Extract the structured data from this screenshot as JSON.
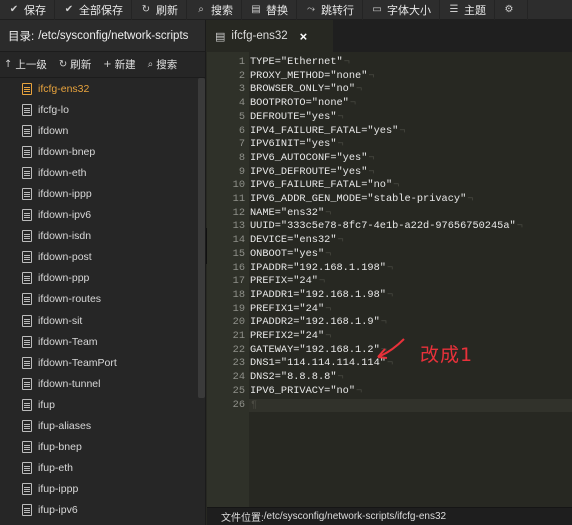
{
  "toolbar": {
    "buttons": [
      {
        "icon": "save-icon",
        "glyph": "✔",
        "label": "保存"
      },
      {
        "icon": "save-all-icon",
        "glyph": "✔",
        "label": "全部保存"
      },
      {
        "icon": "refresh-icon",
        "glyph": "↻",
        "label": "刷新"
      },
      {
        "icon": "search-icon",
        "glyph": "⌕",
        "label": "搜索"
      },
      {
        "icon": "replace-icon",
        "glyph": "▤",
        "label": "替换"
      },
      {
        "icon": "goto-line-icon",
        "glyph": "⤳",
        "label": "跳转行"
      },
      {
        "icon": "font-size-icon",
        "glyph": "▭",
        "label": "字体大小"
      },
      {
        "icon": "theme-icon",
        "glyph": "☰",
        "label": "主题"
      },
      {
        "icon": "settings-icon",
        "glyph": "⚙",
        "label": ""
      }
    ]
  },
  "sidebar": {
    "dir_label": "目录:",
    "dir_path": "/etc/sysconfig/network-scripts",
    "actions": [
      {
        "icon": "up-arrow-icon",
        "glyph": "↑",
        "label": "上一级"
      },
      {
        "icon": "refresh-icon",
        "glyph": "↻",
        "label": "刷新"
      },
      {
        "icon": "plus-icon",
        "glyph": "+",
        "label": "新建"
      },
      {
        "icon": "search-icon",
        "glyph": "⌕",
        "label": "搜索"
      }
    ],
    "files": [
      "ifcfg-ens32",
      "ifcfg-lo",
      "ifdown",
      "ifdown-bnep",
      "ifdown-eth",
      "ifdown-ippp",
      "ifdown-ipv6",
      "ifdown-isdn",
      "ifdown-post",
      "ifdown-ppp",
      "ifdown-routes",
      "ifdown-sit",
      "ifdown-Team",
      "ifdown-TeamPort",
      "ifdown-tunnel",
      "ifup",
      "ifup-aliases",
      "ifup-bnep",
      "ifup-eth",
      "ifup-ippp",
      "ifup-ipv6"
    ],
    "active_file": "ifcfg-ens32"
  },
  "tab": {
    "label": "ifcfg-ens32",
    "close": "×"
  },
  "editor": {
    "lines": [
      "TYPE=\"Ethernet\"",
      "PROXY_METHOD=\"none\"",
      "BROWSER_ONLY=\"no\"",
      "BOOTPROTO=\"none\"",
      "DEFROUTE=\"yes\"",
      "IPV4_FAILURE_FATAL=\"yes\"",
      "IPV6INIT=\"yes\"",
      "IPV6_AUTOCONF=\"yes\"",
      "IPV6_DEFROUTE=\"yes\"",
      "IPV6_FAILURE_FATAL=\"no\"",
      "IPV6_ADDR_GEN_MODE=\"stable-privacy\"",
      "NAME=\"ens32\"",
      "UUID=\"333c5e78-8fc7-4e1b-a22d-97656750245a\"",
      "DEVICE=\"ens32\"",
      "ONBOOT=\"yes\"",
      "IPADDR=\"192.168.1.198\"",
      "PREFIX=\"24\"",
      "IPADDR1=\"192.168.1.98\"",
      "PREFIX1=\"24\"",
      "IPADDR2=\"192.168.1.9\"",
      "PREFIX2=\"24\"",
      "GATEWAY=\"192.168.1.2\"",
      "DNS1=\"114.114.114.114\"",
      "DNS2=\"8.8.8.8\"",
      "IPV6_PRIVACY=\"no\"",
      ""
    ],
    "eol_marker": "¬",
    "last_marker": "¶"
  },
  "annotation": {
    "text": "改成1",
    "color": "#e8313a"
  },
  "status": {
    "label": "文件位置:",
    "path": "/etc/sysconfig/network-scripts/ifcfg-ens32"
  }
}
